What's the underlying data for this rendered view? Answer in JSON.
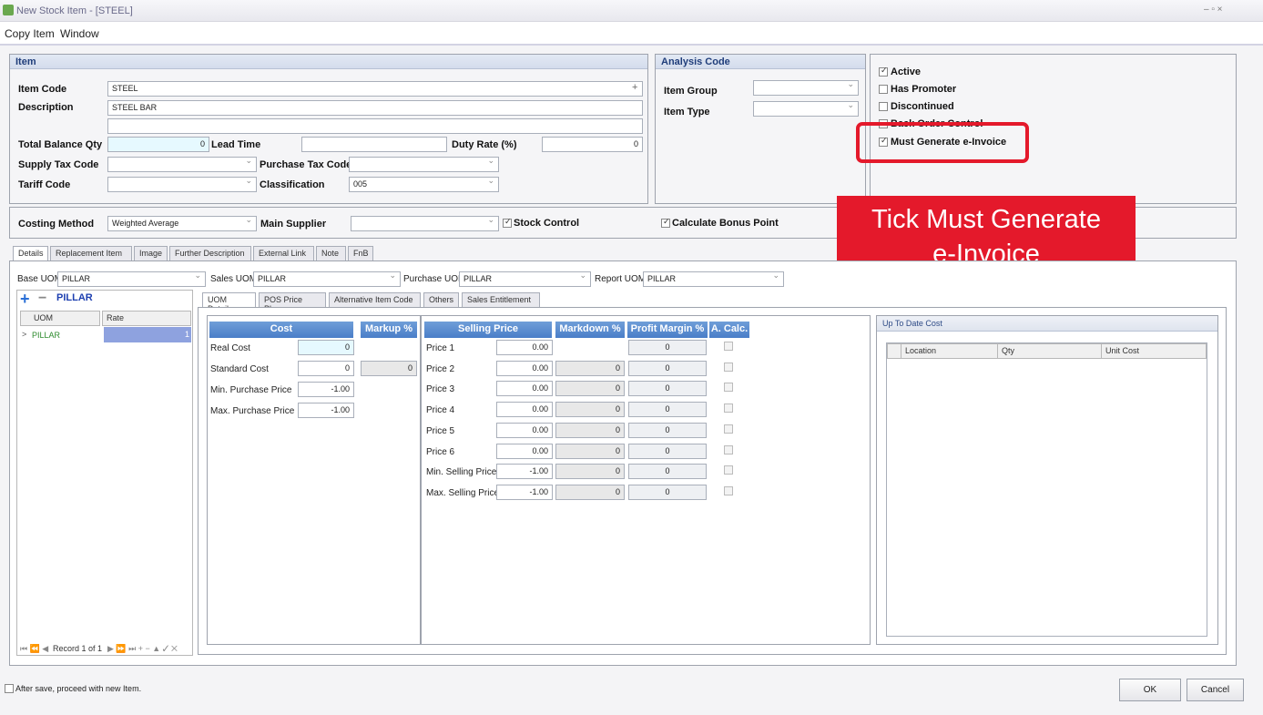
{
  "window": {
    "title": "New Stock Item - [STEEL]",
    "controls": "– ▫ ×"
  },
  "menu": {
    "copy_item": "Copy Item",
    "window": "Window"
  },
  "item": {
    "header": "Item",
    "item_code_label": "Item Code",
    "item_code": "STEEL",
    "plus": "+",
    "description_label": "Description",
    "description": "STEEL BAR",
    "description2": "",
    "total_balance_label": "Total Balance Qty",
    "total_balance": "0",
    "lead_time_label": "Lead Time",
    "lead_time": "",
    "duty_rate_label": "Duty Rate (%)",
    "duty_rate": "0",
    "supply_tax_label": "Supply Tax Code",
    "supply_tax": "",
    "purchase_tax_label": "Purchase Tax Code",
    "purchase_tax": "",
    "tariff_label": "Tariff Code",
    "tariff": "",
    "classification_label": "Classification",
    "classification": "005"
  },
  "analysis": {
    "header": "Analysis Code",
    "item_group_label": "Item Group",
    "item_group": "",
    "item_type_label": "Item Type",
    "item_type": ""
  },
  "flags": {
    "active": "Active",
    "has_promoter": "Has Promoter",
    "discontinued": "Discontinued",
    "back_order": "Back Order Control",
    "must_einvoice": "Must Generate e-Invoice"
  },
  "costing": {
    "method_label": "Costing Method",
    "method": "Weighted Average",
    "main_supplier_label": "Main Supplier",
    "main_supplier": "",
    "stock_control": "Stock Control",
    "bonus_point": "Calculate Bonus Point"
  },
  "callout": {
    "line1": "Tick Must Generate",
    "line2": "e-Invoice"
  },
  "tabs": [
    "Details",
    "Replacement Item",
    "Image",
    "Further Description",
    "External Link",
    "Note",
    "FnB"
  ],
  "uom_bar": {
    "base_label": "Base UOM",
    "base": "PILLAR",
    "sales_label": "Sales UOM",
    "sales": "PILLAR",
    "purchase_label": "Purchase UOM",
    "purchase": "PILLAR",
    "report_label": "Report UOM",
    "report": "PILLAR"
  },
  "uom_list": {
    "title": "PILLAR",
    "col_uom": "UOM",
    "col_rate": "Rate",
    "row_uom": "PILLAR",
    "row_rate": "1",
    "nav": "Record 1 of 1"
  },
  "subtabs": [
    "UOM Details",
    "POS Price Plan",
    "Alternative Item Code",
    "Others",
    "Sales Entitlement"
  ],
  "cost": {
    "header": "Cost",
    "markup_header": "Markup %",
    "real_label": "Real Cost",
    "real": "0",
    "std_label": "Standard Cost",
    "std": "0",
    "std_markup": "0",
    "minp_label": "Min. Purchase Price",
    "minp": "-1.00",
    "maxp_label": "Max. Purchase Price",
    "maxp": "-1.00"
  },
  "selling": {
    "header": "Selling Price",
    "markdown_header": "Markdown %",
    "margin_header": "Profit Margin %",
    "acalc_header": "A. Calc.",
    "rows": [
      {
        "label": "Price 1",
        "price": "0.00",
        "markdown": "",
        "margin": "0"
      },
      {
        "label": "Price 2",
        "price": "0.00",
        "markdown": "0",
        "margin": "0"
      },
      {
        "label": "Price 3",
        "price": "0.00",
        "markdown": "0",
        "margin": "0"
      },
      {
        "label": "Price 4",
        "price": "0.00",
        "markdown": "0",
        "margin": "0"
      },
      {
        "label": "Price 5",
        "price": "0.00",
        "markdown": "0",
        "margin": "0"
      },
      {
        "label": "Price 6",
        "price": "0.00",
        "markdown": "0",
        "margin": "0"
      },
      {
        "label": "Min. Selling Price",
        "price": "-1.00",
        "markdown": "0",
        "margin": "0"
      },
      {
        "label": "Max. Selling Price",
        "price": "-1.00",
        "markdown": "0",
        "margin": "0"
      }
    ]
  },
  "utd": {
    "header": "Up To Date Cost",
    "col_location": "Location",
    "col_qty": "Qty",
    "col_unit_cost": "Unit Cost"
  },
  "footer": {
    "after_save": "After save, proceed with new Item.",
    "ok": "OK",
    "cancel": "Cancel"
  }
}
